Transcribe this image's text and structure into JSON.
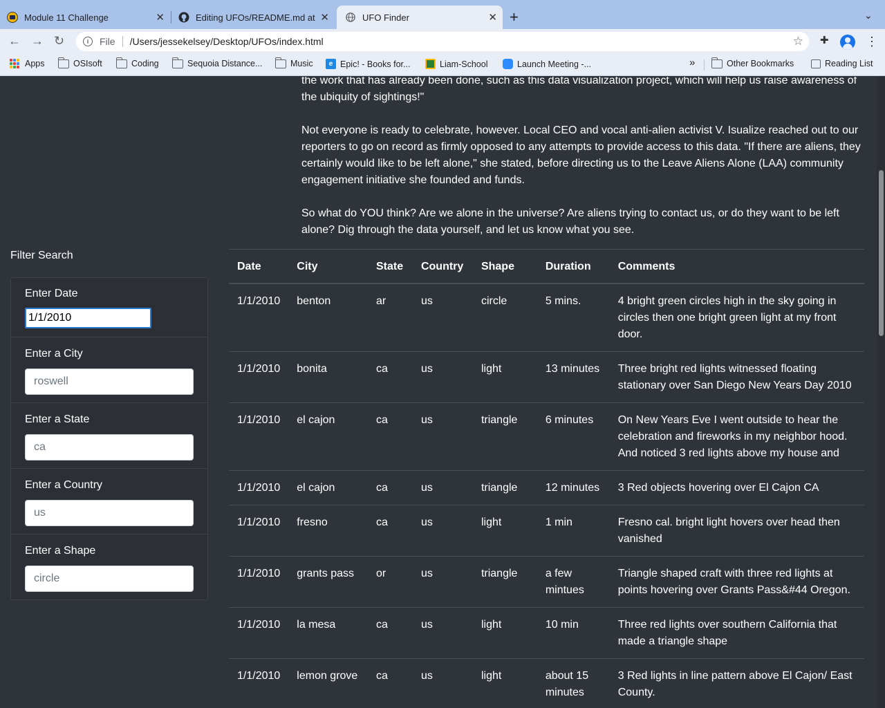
{
  "browser": {
    "tabs": [
      {
        "title": "Module 11 Challenge",
        "close": "✕"
      },
      {
        "title": "Editing UFOs/README.md at m",
        "close": "✕"
      },
      {
        "title": "UFO Finder",
        "close": "✕"
      }
    ],
    "new_tab": "+",
    "tab_menu": "⌄",
    "url_scheme": "File",
    "url_path": "/Users/jessekelsey/Desktop/UFOs/index.html",
    "bookmarks": [
      {
        "label": "Apps"
      },
      {
        "label": "OSIsoft"
      },
      {
        "label": "Coding"
      },
      {
        "label": "Sequoia Distance..."
      },
      {
        "label": "Music"
      },
      {
        "label": "Epic! - Books for..."
      },
      {
        "label": "Liam-School"
      },
      {
        "label": "Launch Meeting -..."
      }
    ],
    "overflow": "»",
    "other_bookmarks": "Other Bookmarks",
    "reading_list": "Reading List"
  },
  "article": {
    "paragraphs": [
      "the work that has already been done, such as this data visualization project, which will help us raise awareness of the ubiquity of sightings!\"",
      "Not everyone is ready to celebrate, however. Local CEO and vocal anti-alien activist V. Isualize reached out to our reporters to go on record as firmly opposed to any attempts to provide access to this data. \"If there are aliens, they certainly would like to be left alone,\" she stated, before directing us to the Leave Aliens Alone (LAA) community engagement initiative she founded and funds.",
      "So what do YOU think? Are we alone in the universe? Are aliens trying to contact us, or do they want to be left alone? Dig through the data yourself, and let us know what you see."
    ]
  },
  "filters": {
    "title": "Filter Search",
    "date": {
      "label": "Enter Date",
      "value": "1/1/2010"
    },
    "city": {
      "label": "Enter a City",
      "placeholder": "roswell"
    },
    "state": {
      "label": "Enter a State",
      "placeholder": "ca"
    },
    "country": {
      "label": "Enter a Country",
      "placeholder": "us"
    },
    "shape": {
      "label": "Enter a Shape",
      "placeholder": "circle"
    }
  },
  "table": {
    "headers": [
      "Date",
      "City",
      "State",
      "Country",
      "Shape",
      "Duration",
      "Comments"
    ],
    "rows": [
      [
        "1/1/2010",
        "benton",
        "ar",
        "us",
        "circle",
        "5 mins.",
        "4 bright green circles high in the sky going in circles then one bright green light at my front door."
      ],
      [
        "1/1/2010",
        "bonita",
        "ca",
        "us",
        "light",
        "13 minutes",
        "Three bright red lights witnessed floating stationary over San Diego New Years Day 2010"
      ],
      [
        "1/1/2010",
        "el cajon",
        "ca",
        "us",
        "triangle",
        "6 minutes",
        "On New Years Eve I went outside to hear the celebration and fireworks in my neighbor hood. And noticed 3 red lights above my house and"
      ],
      [
        "1/1/2010",
        "el cajon",
        "ca",
        "us",
        "triangle",
        "12 minutes",
        "3 Red objects hovering over El Cajon CA"
      ],
      [
        "1/1/2010",
        "fresno",
        "ca",
        "us",
        "light",
        "1 min",
        "Fresno cal. bright light hovers over head then vanished"
      ],
      [
        "1/1/2010",
        "grants pass",
        "or",
        "us",
        "triangle",
        "a few mintues",
        "Triangle shaped craft with three red lights at points hovering over Grants Pass&#44 Oregon."
      ],
      [
        "1/1/2010",
        "la mesa",
        "ca",
        "us",
        "light",
        "10 min",
        "Three red lights over southern California that made a triangle shape"
      ],
      [
        "1/1/2010",
        "lemon grove",
        "ca",
        "us",
        "light",
        "about 15 minutes",
        "3 Red lights in line pattern above El Cajon/ East County."
      ]
    ]
  }
}
